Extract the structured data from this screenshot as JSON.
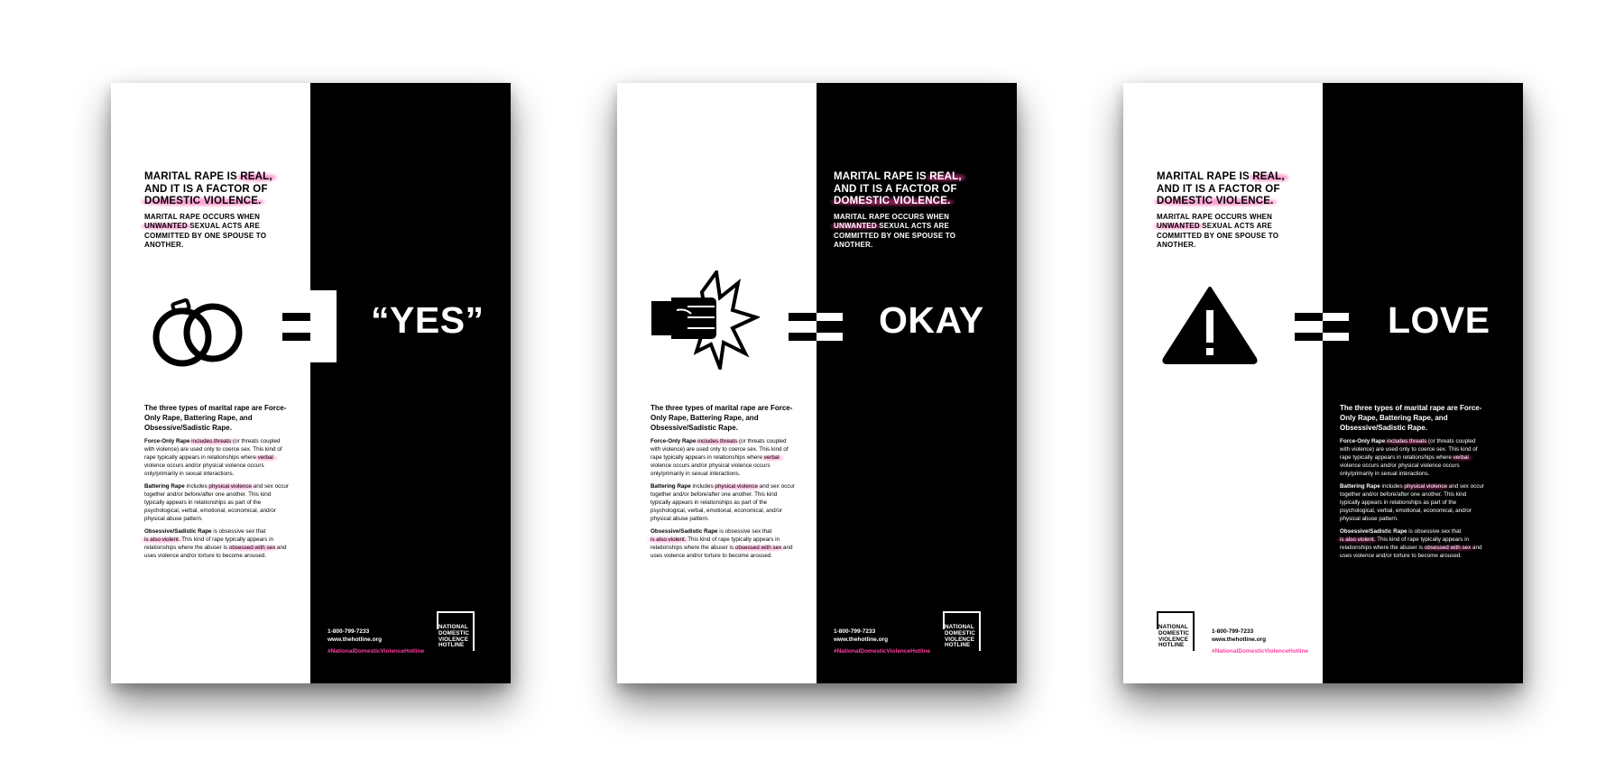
{
  "headline": {
    "prefix": "MARITAL RAPE IS ",
    "real": "REAL,",
    "line2": "AND IT IS A FACTOR OF",
    "dv": "DOMESTIC VIOLENCE."
  },
  "subhead": {
    "prefix": "MARITAL RAPE OCCURS WHEN",
    "unwanted": "UNWANTED",
    "rest": " SEXUAL ACTS ARE COMMITTED BY ONE SPOUSE TO ANOTHER."
  },
  "words": {
    "poster1": "“YES”",
    "poster2": "OKAY",
    "poster3": "LOVE"
  },
  "body": {
    "intro": "The three types of marital rape are Force-Only Rape, Battering Rape, and Obsessive/Sadistic Rape.",
    "force_title": "Force-Only Rape",
    "force_hl": "includes threats",
    "force_mid": " (or threats coupled with violence) are used only to coerce sex. This kind of rape typically appears in relationships where ",
    "force_hl2": "verbal",
    "force_end": " violence occurs and/or physical violence occurs only/primarily in sexual interactions.",
    "batter_title": "Battering Rape",
    "batter_pre": " includes ",
    "batter_hl": "physical violence",
    "batter_end": " and sex occur together and/or before/after one another. This kind typically appears in relationships as part of the psychological, verbal, emotional, economical, and/or physical abuse pattern.",
    "obs_title": "Obsessive/Sadistic Rape",
    "obs_pre": " is obsessive sex that ",
    "obs_hl": "is also violent",
    "obs_mid": ". This kind of rape typically appears in relationships where the abuser is ",
    "obs_hl2": "obsessed with sex",
    "obs_end": " and uses violence and/or torture to become aroused."
  },
  "contact": {
    "phone": "1-800-799-7233",
    "site": "www.thehotline.org",
    "hashtag": "#NationalDomesticViolenceHotline"
  },
  "logo": {
    "l1": "NATIONAL",
    "l2": "DOMESTIC",
    "l3": "VIOLENCE",
    "l4": "HOTLINE"
  },
  "icons": {
    "poster1": "wedding-rings-icon",
    "poster2": "fist-punch-icon",
    "poster3": "warning-triangle-icon",
    "operator": "not-equal-sign"
  },
  "colors": {
    "highlight": "#ff3fa4",
    "black": "#000000",
    "white": "#ffffff"
  }
}
